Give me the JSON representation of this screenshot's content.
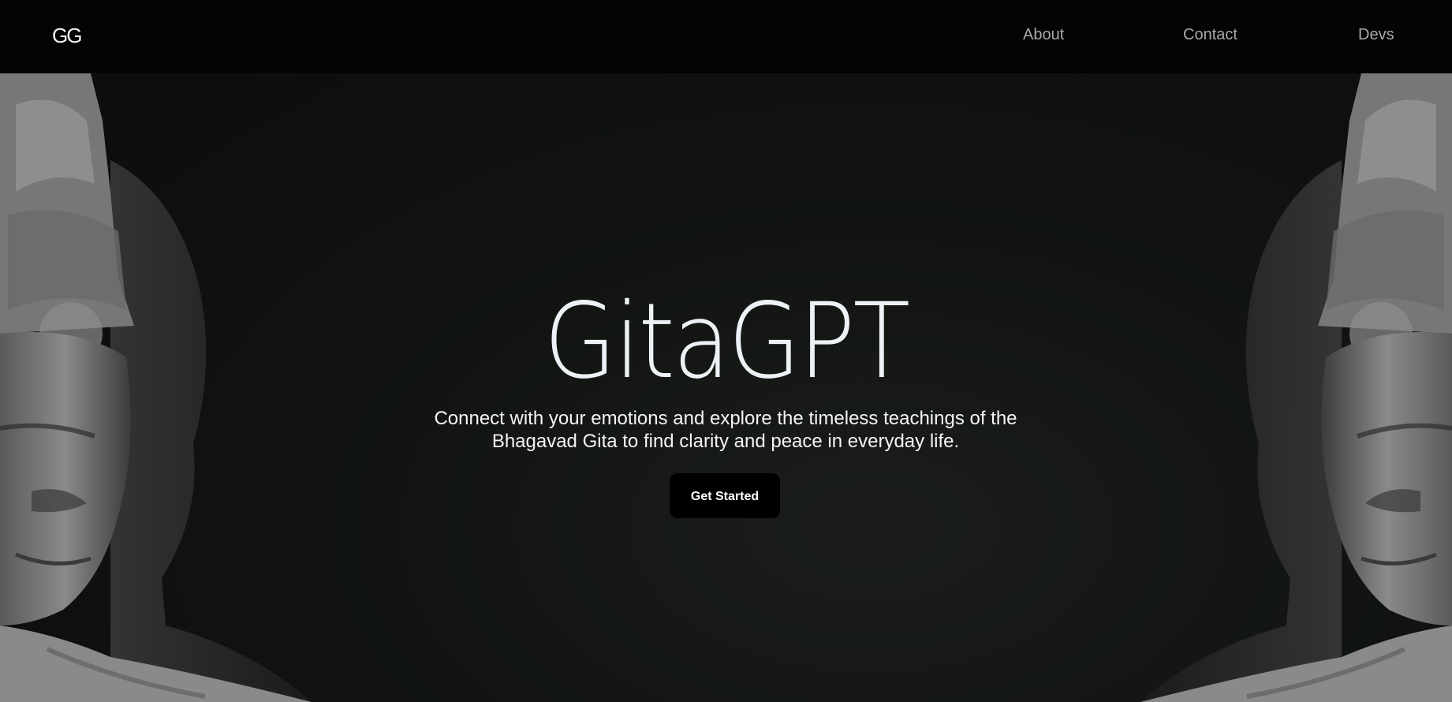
{
  "header": {
    "logo_text": "GG",
    "nav": [
      {
        "label": "About"
      },
      {
        "label": "Contact"
      },
      {
        "label": "Devs"
      }
    ]
  },
  "hero": {
    "title": "GitaGPT",
    "subtitle": "Connect with your emotions and explore the timeless teachings of the Bhagavad Gita to find clarity and peace in everyday life.",
    "cta_label": "Get Started"
  },
  "images": {
    "left": "stone-deity-statue",
    "right": "stone-deity-statue-mirrored"
  },
  "colors": {
    "background": "#0a0c0a",
    "navbar": "#030503",
    "nav_text": "#a9a9a9",
    "title_text": "#eef1f5",
    "button_bg": "#000000",
    "button_text": "#ffffff"
  }
}
